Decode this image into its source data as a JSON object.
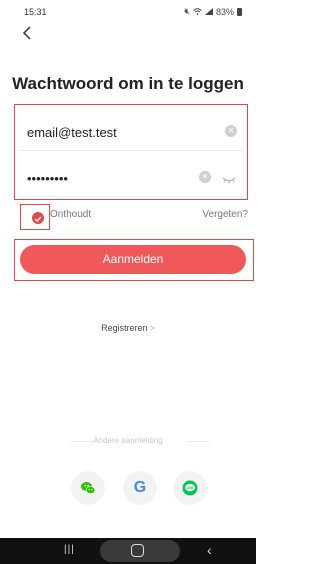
{
  "status_bar": {
    "time": "15:31",
    "battery": "83%",
    "icons": [
      "mute-icon",
      "wifi-icon",
      "signal-icon",
      "battery-icon"
    ]
  },
  "header": {
    "back_icon": "chevron-left-icon",
    "title": "Wachtwoord om in te loggen"
  },
  "form": {
    "email_value": "email@test.test",
    "password_value": "•••••••••",
    "remember_label": "Onthoudt",
    "remember_checked": true,
    "forgot_label": "Vergeten?",
    "login_label": "Aanmelden"
  },
  "register": {
    "label": "Registreren",
    "chevron": ">"
  },
  "other_login": {
    "label": "Andere aanmelding",
    "providers": [
      {
        "icon": "wechat-icon",
        "color": "#2dc100"
      },
      {
        "icon": "google-icon",
        "color": "#4285f4"
      },
      {
        "icon": "line-icon",
        "color": "#06c755"
      }
    ]
  },
  "colors": {
    "accent": "#f15859",
    "highlight_border": "#e04949"
  },
  "nav_bar": {
    "icons": [
      "recent-apps-icon",
      "home-icon",
      "back-icon"
    ]
  }
}
